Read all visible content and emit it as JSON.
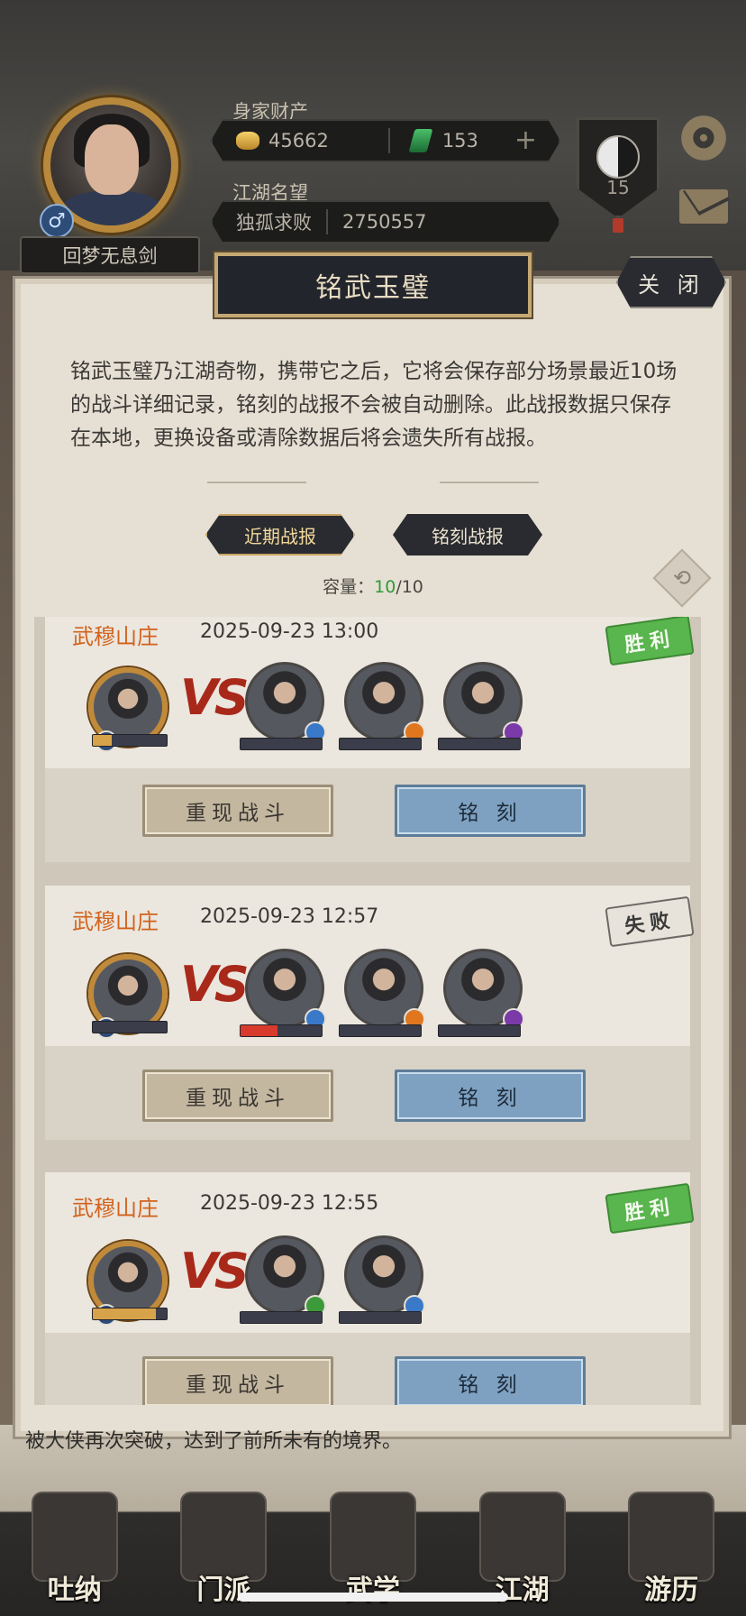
{
  "header": {
    "player_name": "回梦无息剑",
    "gender_symbol": "♂",
    "wealth_label": "身家财产",
    "gold": "45662",
    "jade": "153",
    "add_symbol": "+",
    "fame_label": "江湖名望",
    "fame_title": "独孤求败",
    "fame_value": "2750557",
    "level": "15",
    "gear_symbol": "⚙"
  },
  "panel": {
    "title": "铭武玉璧",
    "close_label": "关 闭",
    "description": "铭武玉璧乃江湖奇物，携带它之后，它将会保存部分场景最近10场的战斗详细记录，铭刻的战报不会被自动删除。此战报数据只保存在本地，更换设备或清除数据后将会遗失所有战报。",
    "tabs": [
      {
        "label": "近期战报",
        "active": true
      },
      {
        "label": "铭刻战报",
        "active": false
      }
    ],
    "capacity_label": "容量：",
    "capacity_used": "10",
    "capacity_total": "/10",
    "swap_symbol": "⟲"
  },
  "battles": [
    {
      "place": "武穆山庄",
      "time": "2025-09-23 13:00",
      "result": "胜利",
      "result_type": "win",
      "self_hp": 0.25,
      "opponents": [
        {
          "element": "water",
          "color": "#3a78c8",
          "hp": 0
        },
        {
          "element": "fire",
          "color": "#e0771e",
          "hp": 0
        },
        {
          "element": "poison",
          "color": "#7a3aa8",
          "hp": 0
        }
      ],
      "replay_label": "重现战斗",
      "engrave_label": "铭 刻"
    },
    {
      "place": "武穆山庄",
      "time": "2025-09-23 12:57",
      "result": "失败",
      "result_type": "lose",
      "self_hp": 0,
      "opponents": [
        {
          "element": "water",
          "color": "#3a78c8",
          "hp": 0.45
        },
        {
          "element": "fire",
          "color": "#e0771e",
          "hp": 0
        },
        {
          "element": "poison",
          "color": "#7a3aa8",
          "hp": 0
        }
      ],
      "replay_label": "重现战斗",
      "engrave_label": "铭 刻"
    },
    {
      "place": "武穆山庄",
      "time": "2025-09-23 12:55",
      "result": "胜利",
      "result_type": "win",
      "self_hp": 0.85,
      "opponents": [
        {
          "element": "wood",
          "color": "#3c9a3a",
          "hp": 0
        },
        {
          "element": "water",
          "color": "#3a78c8",
          "hp": 0
        }
      ],
      "replay_label": "重现战斗",
      "engrave_label": "铭 刻"
    }
  ],
  "vs_text": "VS",
  "footer_text": "被大侠再次突破，达到了前所未有的境界。",
  "bottom_nav": [
    {
      "label": "吐纳"
    },
    {
      "label": "门派"
    },
    {
      "label": "武学"
    },
    {
      "label": "江湖"
    },
    {
      "label": "游历"
    }
  ],
  "colors": {
    "win": "#59b54d",
    "lose": "#e8e3da",
    "hp_self": "#d6a24a",
    "hp_enemy": "#d83a2c",
    "place": "#d2621c"
  }
}
